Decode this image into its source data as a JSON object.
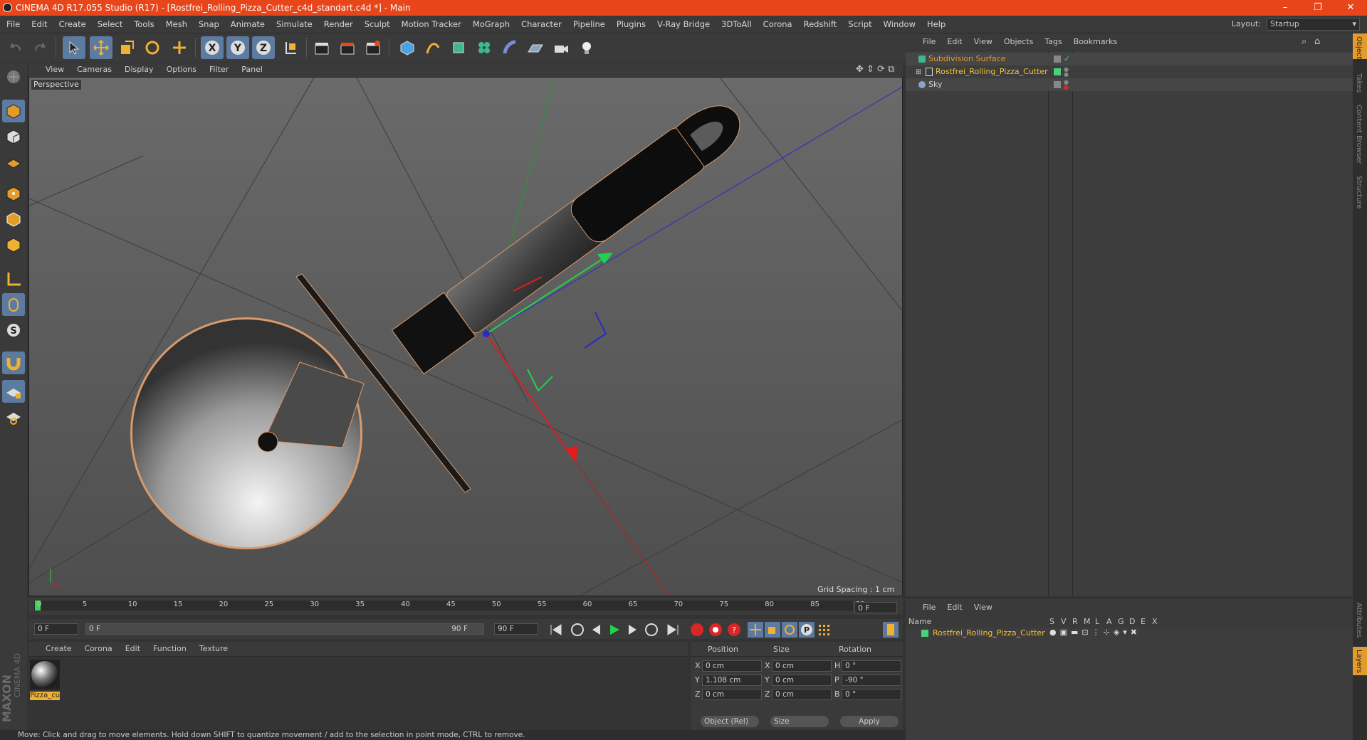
{
  "window": {
    "title": "CINEMA 4D R17.055 Studio (R17) - [Rostfrei_Rolling_Pizza_Cutter_c4d_standart.c4d *] - Main",
    "minimize": "–",
    "restore": "❐",
    "close": "✕"
  },
  "menu": [
    "File",
    "Edit",
    "Create",
    "Select",
    "Tools",
    "Mesh",
    "Snap",
    "Animate",
    "Simulate",
    "Render",
    "Sculpt",
    "Motion Tracker",
    "MoGraph",
    "Character",
    "Pipeline",
    "Plugins",
    "V-Ray Bridge",
    "3DToAll",
    "Corona",
    "Redshift",
    "Script",
    "Window",
    "Help"
  ],
  "layout": {
    "label": "Layout:",
    "value": "Startup"
  },
  "viewport": {
    "menu": [
      "View",
      "Cameras",
      "Display",
      "Options",
      "Filter",
      "Panel"
    ],
    "label": "Perspective",
    "grid_spacing": "Grid Spacing : 1 cm"
  },
  "timeline": {
    "ticks": [
      "0",
      "5",
      "10",
      "15",
      "20",
      "25",
      "30",
      "35",
      "40",
      "45",
      "50",
      "55",
      "60",
      "65",
      "70",
      "75",
      "80",
      "85",
      "90"
    ],
    "current_frame": "0 F",
    "start_field": "0 F",
    "range_start": "0 F",
    "range_end": "90 F",
    "end_field": "90 F"
  },
  "materials": {
    "menu": [
      "Create",
      "Corona",
      "Edit",
      "Function",
      "Texture"
    ],
    "items": [
      {
        "label": "Pizza_cu"
      }
    ]
  },
  "coords": {
    "headers": [
      "Position",
      "Size",
      "Rotation"
    ],
    "rows": [
      {
        "axis": "X",
        "pos": "0 cm",
        "saxis": "X",
        "size": "0 cm",
        "raxis": "H",
        "rot": "0 °"
      },
      {
        "axis": "Y",
        "pos": "1.108 cm",
        "saxis": "Y",
        "size": "0 cm",
        "raxis": "P",
        "rot": "-90 °"
      },
      {
        "axis": "Z",
        "pos": "0 cm",
        "saxis": "Z",
        "size": "0 cm",
        "raxis": "B",
        "rot": "0 °"
      }
    ],
    "mode": "Object (Rel)",
    "size_mode": "Size",
    "apply": "Apply"
  },
  "status": "Move: Click and drag to move elements. Hold down SHIFT to quantize movement / add to the selection in point mode, CTRL to remove.",
  "objects": {
    "menu": [
      "File",
      "Edit",
      "View",
      "Objects",
      "Tags",
      "Bookmarks"
    ],
    "tree": [
      {
        "name": "Subdivision Surface"
      },
      {
        "name": "Rostfrei_Rolling_Pizza_Cutter"
      },
      {
        "name": "Sky"
      }
    ]
  },
  "layers": {
    "menu": [
      "File",
      "Edit",
      "View"
    ],
    "headers": [
      "Name",
      "S",
      "V",
      "R",
      "M",
      "L",
      "A",
      "G",
      "D",
      "E",
      "X"
    ],
    "rows": [
      {
        "name": "Rostfrei_Rolling_Pizza_Cutter"
      }
    ]
  },
  "right_tabs": [
    "Objects",
    "Takes",
    "Content Browser",
    "Structure",
    "Attributes",
    "Layers"
  ],
  "brand": {
    "line1": "MAXON",
    "line2": "CINEMA 4D"
  },
  "colors": {
    "accent": "#e8461a",
    "selected": "#5d7aa0",
    "object_name": "#f3c238"
  }
}
